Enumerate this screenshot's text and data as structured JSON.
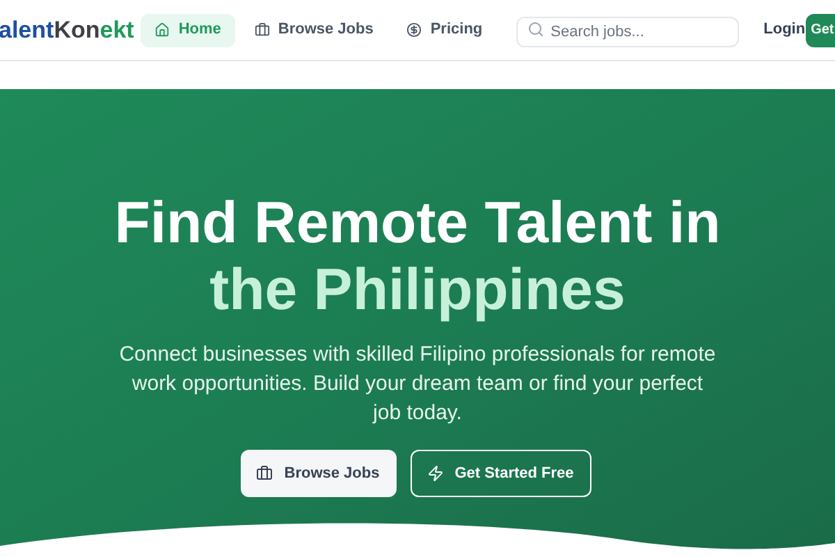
{
  "header": {
    "logo": [
      {
        "text": "alent",
        "color": "#1e4fa0"
      },
      {
        "text": "Kon",
        "color": "#3f3f46"
      },
      {
        "text": "ekt",
        "color": "#1f9a5c"
      }
    ],
    "nav": [
      {
        "label": "Home",
        "selected": true
      },
      {
        "label": "Browse Jobs",
        "selected": false
      },
      {
        "label": "Pricing",
        "selected": false
      }
    ],
    "search": {
      "placeholder": "Search jobs..."
    },
    "login": "Login",
    "cta": "Get"
  },
  "hero": {
    "title_lines": [
      {
        "text": "Find Remote Talent in",
        "highlight": false
      },
      {
        "text": "the Philippines",
        "highlight": true
      }
    ],
    "subtitle": "Connect businesses with skilled Filipino professionals for remote work opportunities. Build your dream team or find your perfect job today.",
    "buttons": [
      {
        "label": "Browse Jobs",
        "kind": "primary"
      },
      {
        "label": "Get Started Free",
        "kind": "outline"
      }
    ]
  }
}
